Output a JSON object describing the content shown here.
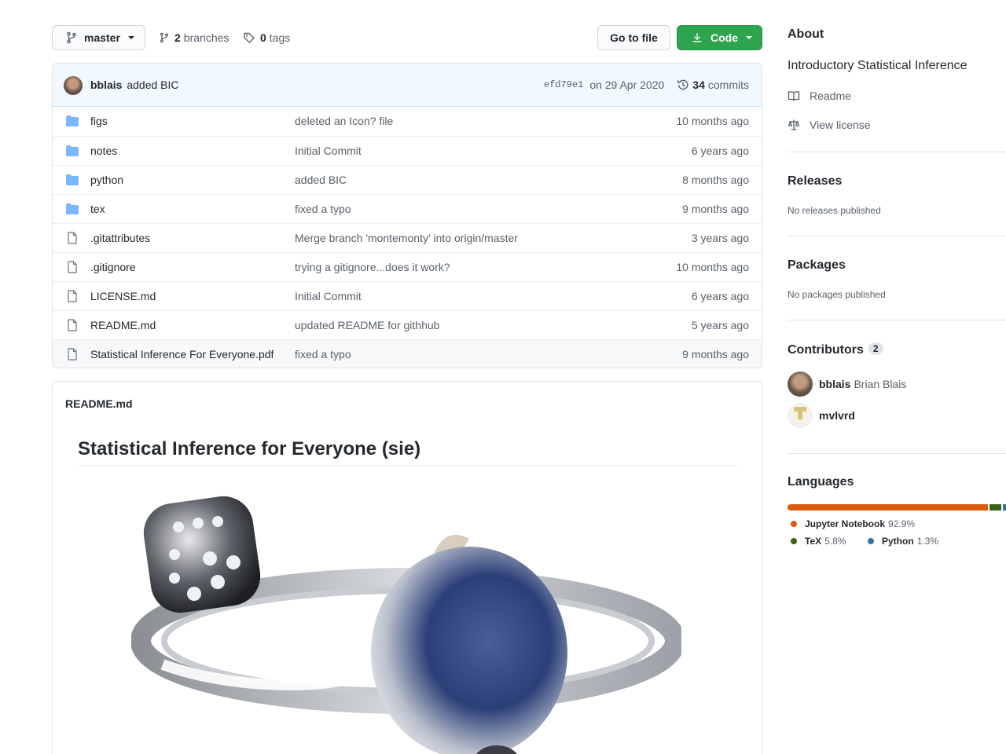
{
  "branch": {
    "name": "master",
    "branches_count": "2",
    "branches_label": "branches",
    "tags_count": "0",
    "tags_label": "tags"
  },
  "toolbar": {
    "goto_label": "Go to file",
    "code_label": "Code"
  },
  "latest_commit": {
    "author": "bblais",
    "message": "added BIC",
    "sha": "efd79e1",
    "date": "on 29 Apr 2020",
    "commits_count": "34",
    "commits_label": "commits"
  },
  "files": [
    {
      "type": "dir",
      "name": "figs",
      "message": "deleted an Icon? file",
      "age": "10 months ago"
    },
    {
      "type": "dir",
      "name": "notes",
      "message": "Initial Commit",
      "age": "6 years ago"
    },
    {
      "type": "dir",
      "name": "python",
      "message": "added BIC",
      "age": "8 months ago"
    },
    {
      "type": "dir",
      "name": "tex",
      "message": "fixed a typo",
      "age": "9 months ago"
    },
    {
      "type": "file",
      "name": ".gitattributes",
      "message": "Merge branch 'montemonty' into origin/master",
      "age": "3 years ago"
    },
    {
      "type": "file",
      "name": ".gitignore",
      "message": "trying a gitignore...does it work?",
      "age": "10 months ago"
    },
    {
      "type": "file",
      "name": "LICENSE.md",
      "message": "Initial Commit",
      "age": "6 years ago"
    },
    {
      "type": "file",
      "name": "README.md",
      "message": "updated README for githhub",
      "age": "5 years ago"
    },
    {
      "type": "file",
      "name": "Statistical Inference For Everyone.pdf",
      "message": "fixed a typo",
      "age": "9 months ago"
    }
  ],
  "readme": {
    "filename": "README.md",
    "heading": "Statistical Inference for Everyone (sie)"
  },
  "about": {
    "title": "About",
    "description": "Introductory Statistical Inference",
    "readme_label": "Readme",
    "license_label": "View license"
  },
  "releases": {
    "title": "Releases",
    "empty": "No releases published"
  },
  "packages": {
    "title": "Packages",
    "empty": "No packages published"
  },
  "contributors": {
    "title": "Contributors",
    "count": "2",
    "list": [
      {
        "login": "bblais",
        "name": "Brian Blais"
      },
      {
        "login": "mvlvrd",
        "name": ""
      }
    ]
  },
  "languages": {
    "title": "Languages",
    "items": [
      {
        "name": "Jupyter Notebook",
        "percent": "92.9%",
        "value": 92.9,
        "color": "#DA5B0B"
      },
      {
        "name": "TeX",
        "percent": "5.8%",
        "value": 5.8,
        "color": "#3D6117"
      },
      {
        "name": "Python",
        "percent": "1.3%",
        "value": 1.3,
        "color": "#3572A5"
      }
    ]
  }
}
